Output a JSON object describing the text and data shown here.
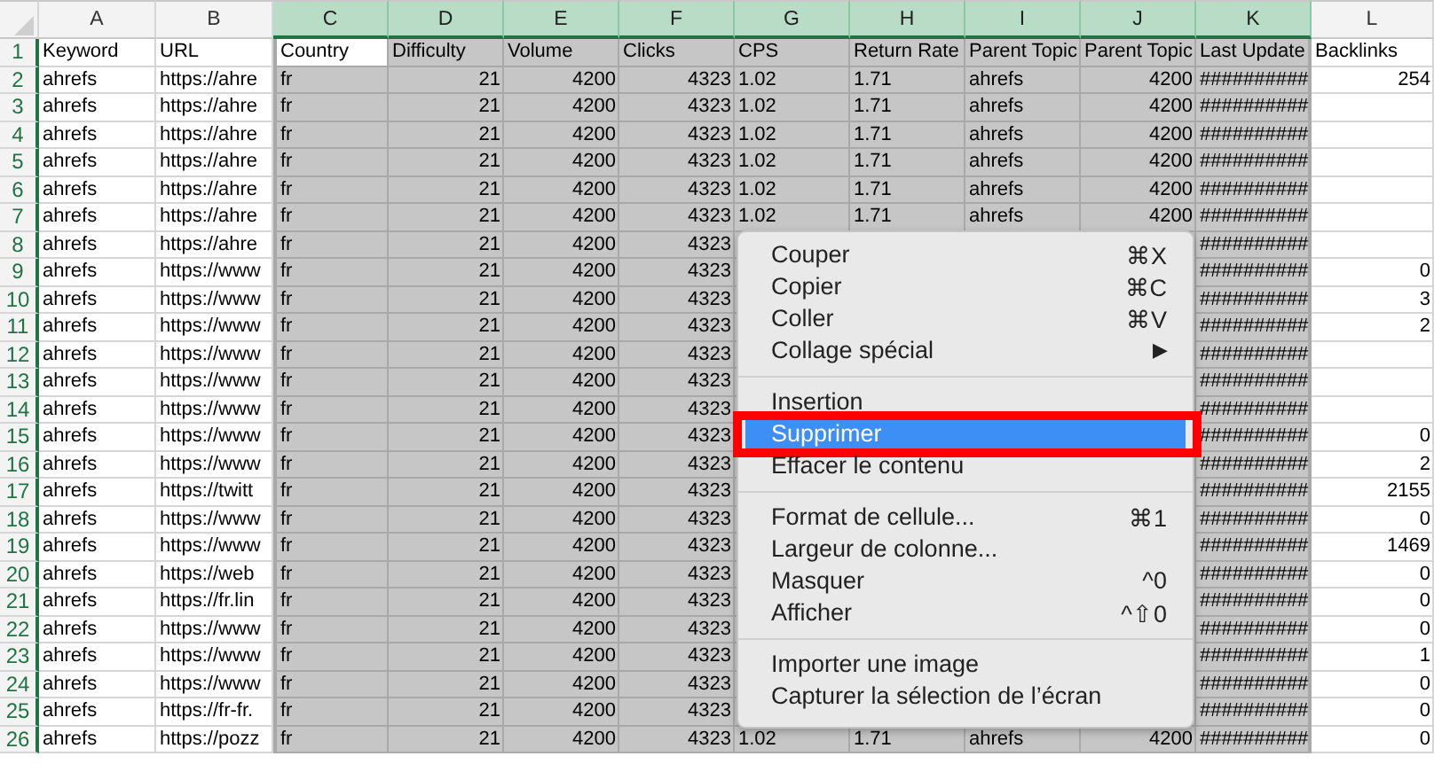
{
  "columns": [
    {
      "letter": "A",
      "selected": false
    },
    {
      "letter": "B",
      "selected": false
    },
    {
      "letter": "C",
      "selected": true
    },
    {
      "letter": "D",
      "selected": true
    },
    {
      "letter": "E",
      "selected": true
    },
    {
      "letter": "F",
      "selected": true
    },
    {
      "letter": "G",
      "selected": true
    },
    {
      "letter": "H",
      "selected": true
    },
    {
      "letter": "I",
      "selected": true
    },
    {
      "letter": "J",
      "selected": true
    },
    {
      "letter": "K",
      "selected": true
    },
    {
      "letter": "L",
      "selected": false
    }
  ],
  "rows": [
    {
      "number": "1",
      "cells": [
        "Keyword",
        "URL",
        "Country",
        "Difficulty",
        "Volume",
        "Clicks",
        "CPS",
        "Return Rate",
        "Parent Topic",
        "Parent Topic",
        "Last Update",
        "Backlinks"
      ]
    },
    {
      "number": "2",
      "cells": [
        "ahrefs",
        "https://ahre",
        "fr",
        "21",
        "4200",
        "4323",
        "1.02",
        "1.71",
        "ahrefs",
        "4200",
        "##########",
        "254"
      ]
    },
    {
      "number": "3",
      "cells": [
        "ahrefs",
        "https://ahre",
        "fr",
        "21",
        "4200",
        "4323",
        "1.02",
        "1.71",
        "ahrefs",
        "4200",
        "##########",
        null
      ]
    },
    {
      "number": "4",
      "cells": [
        "ahrefs",
        "https://ahre",
        "fr",
        "21",
        "4200",
        "4323",
        "1.02",
        "1.71",
        "ahrefs",
        "4200",
        "##########",
        null
      ]
    },
    {
      "number": "5",
      "cells": [
        "ahrefs",
        "https://ahre",
        "fr",
        "21",
        "4200",
        "4323",
        "1.02",
        "1.71",
        "ahrefs",
        "4200",
        "##########",
        null
      ]
    },
    {
      "number": "6",
      "cells": [
        "ahrefs",
        "https://ahre",
        "fr",
        "21",
        "4200",
        "4323",
        "1.02",
        "1.71",
        "ahrefs",
        "4200",
        "##########",
        null
      ]
    },
    {
      "number": "7",
      "cells": [
        "ahrefs",
        "https://ahre",
        "fr",
        "21",
        "4200",
        "4323",
        "1.02",
        "1.71",
        "ahrefs",
        "4200",
        "##########",
        null
      ]
    },
    {
      "number": "8",
      "cells": [
        "ahrefs",
        "https://ahre",
        "fr",
        "21",
        "4200",
        "4323",
        null,
        null,
        null,
        null,
        "##########",
        null
      ]
    },
    {
      "number": "9",
      "cells": [
        "ahrefs",
        "https://www",
        "fr",
        "21",
        "4200",
        "4323",
        null,
        null,
        null,
        null,
        "##########",
        "0"
      ]
    },
    {
      "number": "10",
      "cells": [
        "ahrefs",
        "https://www",
        "fr",
        "21",
        "4200",
        "4323",
        null,
        null,
        null,
        null,
        "##########",
        "3"
      ]
    },
    {
      "number": "11",
      "cells": [
        "ahrefs",
        "https://www",
        "fr",
        "21",
        "4200",
        "4323",
        null,
        null,
        null,
        null,
        "##########",
        "2"
      ]
    },
    {
      "number": "12",
      "cells": [
        "ahrefs",
        "https://www",
        "fr",
        "21",
        "4200",
        "4323",
        null,
        null,
        null,
        null,
        "##########",
        null
      ]
    },
    {
      "number": "13",
      "cells": [
        "ahrefs",
        "https://www",
        "fr",
        "21",
        "4200",
        "4323",
        null,
        null,
        null,
        null,
        "##########",
        null
      ]
    },
    {
      "number": "14",
      "cells": [
        "ahrefs",
        "https://www",
        "fr",
        "21",
        "4200",
        "4323",
        null,
        null,
        null,
        null,
        "##########",
        null
      ]
    },
    {
      "number": "15",
      "cells": [
        "ahrefs",
        "https://www",
        "fr",
        "21",
        "4200",
        "4323",
        null,
        null,
        null,
        null,
        "##########",
        "0"
      ]
    },
    {
      "number": "16",
      "cells": [
        "ahrefs",
        "https://www",
        "fr",
        "21",
        "4200",
        "4323",
        null,
        null,
        null,
        null,
        "##########",
        "2"
      ]
    },
    {
      "number": "17",
      "cells": [
        "ahrefs",
        "https://twitt",
        "fr",
        "21",
        "4200",
        "4323",
        null,
        null,
        null,
        null,
        "##########",
        "2155"
      ]
    },
    {
      "number": "18",
      "cells": [
        "ahrefs",
        "https://www",
        "fr",
        "21",
        "4200",
        "4323",
        null,
        null,
        null,
        null,
        "##########",
        "0"
      ]
    },
    {
      "number": "19",
      "cells": [
        "ahrefs",
        "https://www",
        "fr",
        "21",
        "4200",
        "4323",
        null,
        null,
        null,
        null,
        "##########",
        "1469"
      ]
    },
    {
      "number": "20",
      "cells": [
        "ahrefs",
        "https://web",
        "fr",
        "21",
        "4200",
        "4323",
        null,
        null,
        null,
        null,
        "##########",
        "0"
      ]
    },
    {
      "number": "21",
      "cells": [
        "ahrefs",
        "https://fr.lin",
        "fr",
        "21",
        "4200",
        "4323",
        null,
        null,
        null,
        null,
        "##########",
        "0"
      ]
    },
    {
      "number": "22",
      "cells": [
        "ahrefs",
        "https://www",
        "fr",
        "21",
        "4200",
        "4323",
        null,
        null,
        null,
        null,
        "##########",
        "0"
      ]
    },
    {
      "number": "23",
      "cells": [
        "ahrefs",
        "https://www",
        "fr",
        "21",
        "4200",
        "4323",
        null,
        null,
        null,
        null,
        "##########",
        "1"
      ]
    },
    {
      "number": "24",
      "cells": [
        "ahrefs",
        "https://www",
        "fr",
        "21",
        "4200",
        "4323",
        null,
        null,
        null,
        null,
        "##########",
        "0"
      ]
    },
    {
      "number": "25",
      "cells": [
        "ahrefs",
        "https://fr-fr.",
        "fr",
        "21",
        "4200",
        "4323",
        null,
        null,
        null,
        null,
        "##########",
        "0"
      ]
    },
    {
      "number": "26",
      "cells": [
        "ahrefs",
        "https://pozz",
        "fr",
        "21",
        "4200",
        "4323",
        "1.02",
        "1.71",
        "ahrefs",
        "4200",
        "##########",
        "0"
      ]
    }
  ],
  "context_menu": {
    "items": [
      {
        "kind": "item",
        "label": "Couper",
        "shortcut": "⌘X",
        "selected": false,
        "annotated": false
      },
      {
        "kind": "item",
        "label": "Copier",
        "shortcut": "⌘C",
        "selected": false,
        "annotated": false
      },
      {
        "kind": "item",
        "label": "Coller",
        "shortcut": "⌘V",
        "selected": false,
        "annotated": false
      },
      {
        "kind": "submenu",
        "label": "Collage spécial",
        "arrow": "▶",
        "selected": false,
        "annotated": false
      },
      {
        "kind": "separator"
      },
      {
        "kind": "item",
        "label": "Insertion",
        "selected": false,
        "annotated": false
      },
      {
        "kind": "item",
        "label": "Supprimer",
        "selected": true,
        "annotated": true
      },
      {
        "kind": "item",
        "label": "Effacer le contenu",
        "selected": false,
        "annotated": false
      },
      {
        "kind": "separator"
      },
      {
        "kind": "item",
        "label": "Format de cellule...",
        "shortcut": "⌘1",
        "selected": false,
        "annotated": false
      },
      {
        "kind": "item",
        "label": "Largeur de colonne...",
        "selected": false,
        "annotated": false
      },
      {
        "kind": "item",
        "label": "Masquer",
        "shortcut": "^0",
        "selected": false,
        "annotated": false
      },
      {
        "kind": "item",
        "label": "Afficher",
        "shortcut": "^⇧0",
        "selected": false,
        "annotated": false
      },
      {
        "kind": "separator"
      },
      {
        "kind": "item",
        "label": "Importer une image",
        "selected": false,
        "annotated": false
      },
      {
        "kind": "item",
        "label": "Capturer la sélection de l’écran",
        "selected": false,
        "annotated": false
      }
    ]
  }
}
